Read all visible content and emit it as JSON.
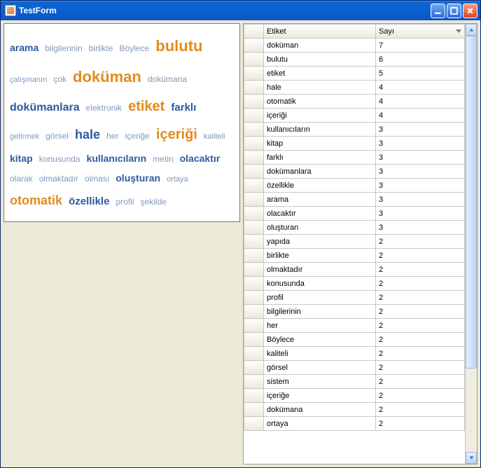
{
  "window": {
    "title": "TestForm"
  },
  "colors": {
    "cloud_strong": "#2c5aa0",
    "cloud_mid": "#7f98bb",
    "cloud_orange": "#e38b1d"
  },
  "cloud": {
    "words": [
      {
        "text": "arama",
        "size": 14,
        "color": "strong",
        "bold": true
      },
      {
        "text": "bilgilerinin",
        "size": 12,
        "color": "mid"
      },
      {
        "text": "birlikte",
        "size": 12,
        "color": "mid"
      },
      {
        "text": "Böylece",
        "size": 12,
        "color": "mid"
      },
      {
        "text": "bulutu",
        "size": 22,
        "color": "orange",
        "bold": true
      },
      {
        "text": "çalışmanın",
        "size": 11,
        "color": "mid"
      },
      {
        "text": "çok",
        "size": 12,
        "color": "mid"
      },
      {
        "text": "doküman",
        "size": 22,
        "color": "orange",
        "bold": true
      },
      {
        "text": "dokümana",
        "size": 12,
        "color": "mid"
      },
      {
        "text": "dokümanlara",
        "size": 16,
        "color": "strong",
        "bold": true
      },
      {
        "text": "elektronik",
        "size": 12,
        "color": "mid"
      },
      {
        "text": "etiket",
        "size": 20,
        "color": "orange",
        "bold": true
      },
      {
        "text": "farklı",
        "size": 15,
        "color": "strong",
        "bold": true
      },
      {
        "text": "getirmek",
        "size": 11,
        "color": "mid"
      },
      {
        "text": "görsel",
        "size": 12,
        "color": "mid"
      },
      {
        "text": "hale",
        "size": 18,
        "color": "strong",
        "bold": true
      },
      {
        "text": "her",
        "size": 12,
        "color": "mid"
      },
      {
        "text": "içeriğe",
        "size": 12,
        "color": "mid"
      },
      {
        "text": "içeriği",
        "size": 20,
        "color": "orange",
        "bold": true
      },
      {
        "text": "kaliteli",
        "size": 11,
        "color": "mid"
      },
      {
        "text": "kitap",
        "size": 14,
        "color": "strong",
        "bold": true
      },
      {
        "text": "konusunda",
        "size": 12,
        "color": "mid"
      },
      {
        "text": "kullanıcıların",
        "size": 14,
        "color": "strong",
        "bold": true
      },
      {
        "text": "metin",
        "size": 12,
        "color": "mid"
      },
      {
        "text": "olacaktır",
        "size": 14,
        "color": "strong",
        "bold": true
      },
      {
        "text": "olarak",
        "size": 12,
        "color": "mid"
      },
      {
        "text": "olmaktadır",
        "size": 12,
        "color": "mid"
      },
      {
        "text": "olması",
        "size": 12,
        "color": "mid"
      },
      {
        "text": "oluşturan",
        "size": 14,
        "color": "strong",
        "bold": true
      },
      {
        "text": "ortaya",
        "size": 11,
        "color": "mid"
      },
      {
        "text": "otomatik",
        "size": 18,
        "color": "orange",
        "bold": true
      },
      {
        "text": "özellikle",
        "size": 15,
        "color": "strong",
        "bold": true
      },
      {
        "text": "profil",
        "size": 12,
        "color": "mid"
      },
      {
        "text": "şekilde",
        "size": 12,
        "color": "mid"
      }
    ]
  },
  "grid": {
    "columns": {
      "etiket": "Etiket",
      "sayi": "Sayı"
    },
    "sort_column": "sayi",
    "sort_dir": "desc",
    "rows": [
      {
        "etiket": "doküman",
        "sayi": 7
      },
      {
        "etiket": "bulutu",
        "sayi": 6
      },
      {
        "etiket": "etiket",
        "sayi": 5
      },
      {
        "etiket": "hale",
        "sayi": 4
      },
      {
        "etiket": "otomatik",
        "sayi": 4
      },
      {
        "etiket": "içeriği",
        "sayi": 4
      },
      {
        "etiket": "kullanıcıların",
        "sayi": 3
      },
      {
        "etiket": "kitap",
        "sayi": 3
      },
      {
        "etiket": "farklı",
        "sayi": 3
      },
      {
        "etiket": "dokümanlara",
        "sayi": 3
      },
      {
        "etiket": "özellikle",
        "sayi": 3
      },
      {
        "etiket": "arama",
        "sayi": 3
      },
      {
        "etiket": "olacaktır",
        "sayi": 3
      },
      {
        "etiket": "oluşturan",
        "sayi": 3
      },
      {
        "etiket": "yapıda",
        "sayi": 2
      },
      {
        "etiket": "birlikte",
        "sayi": 2
      },
      {
        "etiket": "olmaktadır",
        "sayi": 2
      },
      {
        "etiket": "konusunda",
        "sayi": 2
      },
      {
        "etiket": "profil",
        "sayi": 2
      },
      {
        "etiket": "bilgilerinin",
        "sayi": 2
      },
      {
        "etiket": "her",
        "sayi": 2
      },
      {
        "etiket": "Böylece",
        "sayi": 2
      },
      {
        "etiket": "kaliteli",
        "sayi": 2
      },
      {
        "etiket": "görsel",
        "sayi": 2
      },
      {
        "etiket": "sistem",
        "sayi": 2
      },
      {
        "etiket": "içeriğe",
        "sayi": 2
      },
      {
        "etiket": "dokümana",
        "sayi": 2
      },
      {
        "etiket": "ortaya",
        "sayi": 2
      }
    ]
  }
}
